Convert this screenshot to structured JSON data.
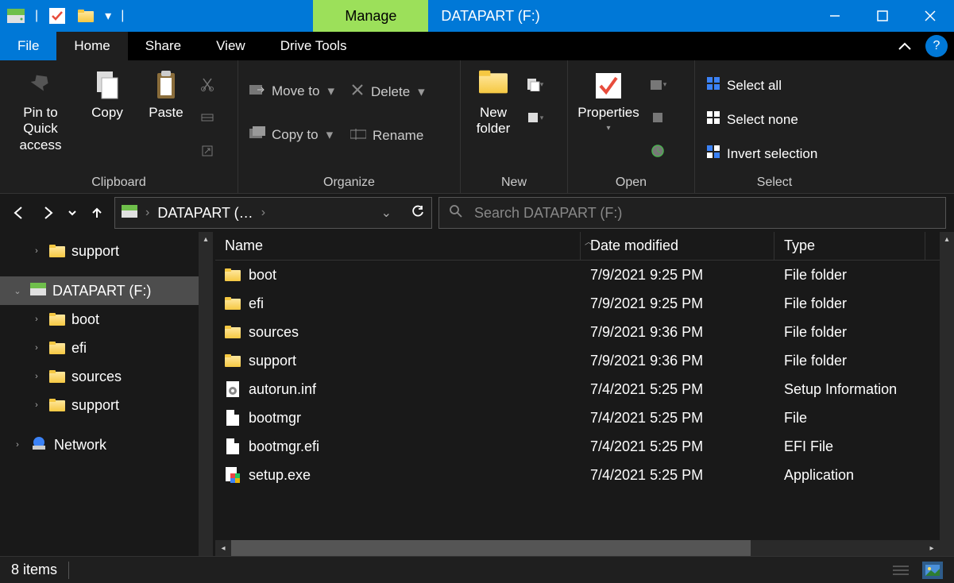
{
  "title": {
    "context_tab": "Manage",
    "window_title": "DATAPART (F:)"
  },
  "tabs": {
    "file": "File",
    "home": "Home",
    "share": "Share",
    "view": "View",
    "drive_tools": "Drive Tools"
  },
  "ribbon": {
    "clipboard": {
      "pin": "Pin to Quick access",
      "copy": "Copy",
      "paste": "Paste",
      "group_label": "Clipboard"
    },
    "organize": {
      "move_to": "Move to",
      "copy_to": "Copy to",
      "delete": "Delete",
      "rename": "Rename",
      "group_label": "Organize"
    },
    "new": {
      "new_folder": "New folder",
      "group_label": "New"
    },
    "open": {
      "properties": "Properties",
      "group_label": "Open"
    },
    "select": {
      "select_all": "Select all",
      "select_none": "Select none",
      "invert": "Invert selection",
      "group_label": "Select"
    }
  },
  "nav": {
    "breadcrumb": "DATAPART (…",
    "search_placeholder": "Search DATAPART (F:)"
  },
  "tree": {
    "items": [
      {
        "label": "support",
        "indent": 1,
        "expanded": false,
        "icon": "folder"
      },
      {
        "label": "DATAPART (F:)",
        "indent": 0,
        "expanded": true,
        "selected": true,
        "icon": "drive"
      },
      {
        "label": "boot",
        "indent": 1,
        "expanded": false,
        "icon": "folder"
      },
      {
        "label": "efi",
        "indent": 1,
        "expanded": false,
        "icon": "folder"
      },
      {
        "label": "sources",
        "indent": 1,
        "expanded": false,
        "icon": "folder"
      },
      {
        "label": "support",
        "indent": 1,
        "expanded": false,
        "icon": "folder"
      },
      {
        "label": "Network",
        "indent": 0,
        "expanded": false,
        "icon": "network"
      }
    ]
  },
  "columns": {
    "name": "Name",
    "date": "Date modified",
    "type": "Type"
  },
  "files": [
    {
      "name": "boot",
      "date": "7/9/2021 9:25 PM",
      "type": "File folder",
      "icon": "folder"
    },
    {
      "name": "efi",
      "date": "7/9/2021 9:25 PM",
      "type": "File folder",
      "icon": "folder"
    },
    {
      "name": "sources",
      "date": "7/9/2021 9:36 PM",
      "type": "File folder",
      "icon": "folder"
    },
    {
      "name": "support",
      "date": "7/9/2021 9:36 PM",
      "type": "File folder",
      "icon": "folder"
    },
    {
      "name": "autorun.inf",
      "date": "7/4/2021 5:25 PM",
      "type": "Setup Information",
      "icon": "inf"
    },
    {
      "name": "bootmgr",
      "date": "7/4/2021 5:25 PM",
      "type": "File",
      "icon": "file"
    },
    {
      "name": "bootmgr.efi",
      "date": "7/4/2021 5:25 PM",
      "type": "EFI File",
      "icon": "file"
    },
    {
      "name": "setup.exe",
      "date": "7/4/2021 5:25 PM",
      "type": "Application",
      "icon": "exe"
    }
  ],
  "status": {
    "items": "8 items"
  }
}
